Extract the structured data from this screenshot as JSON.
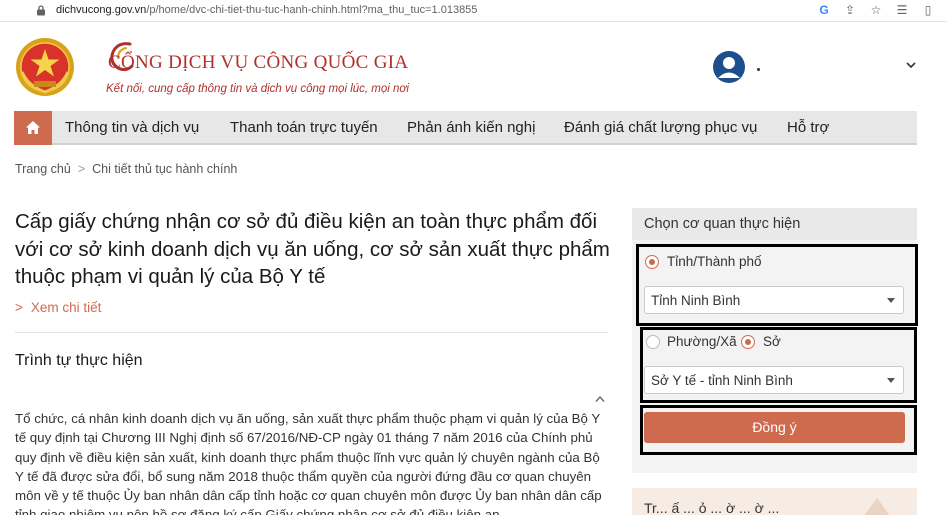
{
  "browser": {
    "url_host": "dichvucong.gov.vn",
    "url_path": "/p/home/dvc-chi-tiet-thu-tuc-hanh-chinh.html?ma_thu_tuc=1.013855"
  },
  "header": {
    "site_title": "CỔNG DỊCH VỤ CÔNG QUỐC GIA",
    "slogan": "Kết nối, cung cấp thông tin và dịch vụ công mọi lúc, mọi nơi"
  },
  "nav": {
    "items": [
      {
        "label": "Thông tin và dịch vụ"
      },
      {
        "label": "Thanh toán trực tuyến"
      },
      {
        "label": "Phản ánh kiến nghị"
      },
      {
        "label": "Đánh giá chất lượng phục vụ"
      },
      {
        "label": "Hỗ trợ"
      }
    ]
  },
  "breadcrumb": {
    "home": "Trang chủ",
    "separator": ">",
    "current": "Chi tiết thủ tục hành chính"
  },
  "main": {
    "title": "Cấp giấy chứng nhận cơ sở đủ điều kiện an toàn thực phẩm đối với cơ sở kinh doanh dịch vụ ăn uống, cơ sở sản xuất thực phẩm thuộc phạm vi quản lý của Bộ Y tế",
    "detail_arrow": ">",
    "detail_link": "Xem chi tiết",
    "section_title": "Trình tự thực hiện",
    "body": "Tổ chức, cá nhân kinh doanh dịch vụ ăn uống, sản xuất thực phẩm thuộc phạm vi quản lý của Bộ Y tế quy định tại Chương III Nghị định số 67/2016/NĐ-CP ngày 01 tháng 7 năm 2016 của Chính phủ quy định về điều kiện sản xuất, kinh doanh thực phẩm thuộc lĩnh vực quản lý chuyên ngành của Bộ Y tế đã được sửa đổi, bổ sung năm 2018 thuộc thẩm quyền của người đứng đầu cơ quan chuyên môn về y tế thuộc Ủy ban nhân dân cấp tỉnh hoặc cơ quan chuyên môn được Ủy ban nhân dân cấp tỉnh giao nhiệm vụ nộp hồ sơ đăng ký cấp Giấy chứng nhận cơ sở đủ điều kiện an"
  },
  "panel": {
    "title": "Chọn cơ quan thực hiện",
    "radio_province": "Tỉnh/Thành phố",
    "province_value": "Tỉnh Ninh Bình",
    "radio_ward": "Phường/Xã",
    "radio_dept": "Sở",
    "dept_value": "Sở Y tế - tỉnh Ninh Bình",
    "submit_label": "Đồng ý"
  },
  "panel2": {
    "title": "Tr... ấ ... ỏ ... ờ ... ờ ..."
  },
  "colors": {
    "accent": "#ce6b4e",
    "brand_red": "#b0302a",
    "nav_bg": "#e7e7e7"
  }
}
